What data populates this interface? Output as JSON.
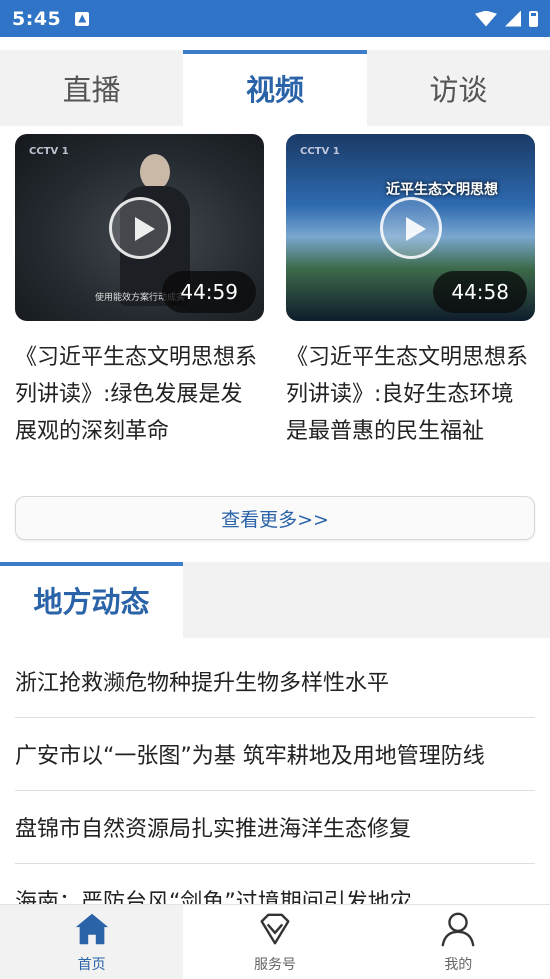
{
  "status_bar": {
    "time": "5:45"
  },
  "tabs": [
    {
      "label": "直播"
    },
    {
      "label": "视频"
    },
    {
      "label": "访谈"
    }
  ],
  "videos": [
    {
      "duration": "44:59",
      "title": "《习近平生态文明思想系列讲读》:绿色发展是发展观的深刻革命",
      "logo": "CCTV 1",
      "caption": "使用能效方案行动成实"
    },
    {
      "duration": "44:58",
      "title": "《习近平生态文明思想系列讲读》:良好生态环境是最普惠的民生福祉",
      "logo": "CCTV 1",
      "stage_text": "近平生态文明思想"
    }
  ],
  "more_label": "查看更多>>",
  "section": {
    "title": "地方动态"
  },
  "news": [
    "浙江抢救濒危物种提升生物多样性水平",
    "广安市以“一张图”为基 筑牢耕地及用地管理防线",
    "盘锦市自然资源局扎实推进海洋生态修复",
    "海南：严防台风“剑鱼”过境期间引发地灾"
  ],
  "bottom_nav": [
    {
      "label": "首页",
      "icon": "home-icon"
    },
    {
      "label": "服务号",
      "icon": "diamond-icon"
    },
    {
      "label": "我的",
      "icon": "user-icon"
    }
  ],
  "colors": {
    "accent": "#2a63a8",
    "status_bar": "#2f74c6"
  }
}
